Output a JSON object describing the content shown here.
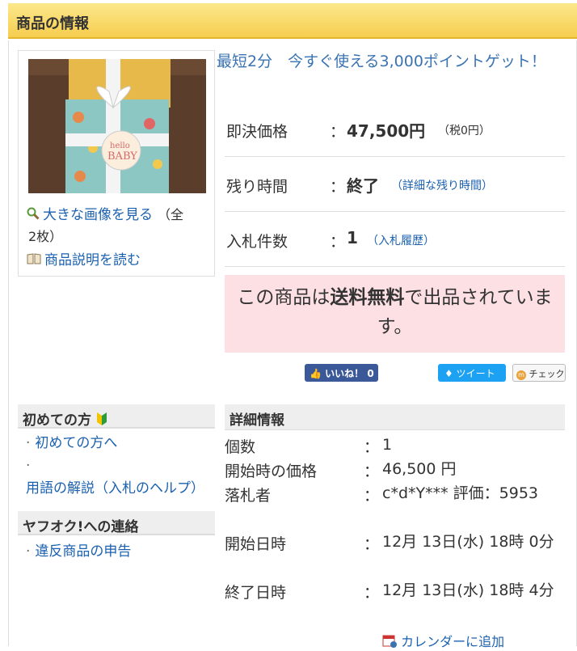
{
  "header": {
    "title": "商品の情報"
  },
  "image_panel": {
    "photo_alt": "商品画像",
    "large_image_link": "大きな画像を見る",
    "image_count": "（全2枚）",
    "description_link": "商品説明を読む"
  },
  "promo": {
    "text": "最短2分　今すぐ使える3,000ポイントゲット！"
  },
  "price": {
    "label": "即決価格",
    "colon": "：",
    "value": "47,500円",
    "tax": "（税0円）"
  },
  "time_left": {
    "label": "残り時間",
    "colon": "：",
    "value": "終了",
    "detail_link": "（詳細な残り時間）"
  },
  "bids": {
    "label": "入札件数",
    "colon": "：",
    "value": "1",
    "history_link": "（入札履歴）"
  },
  "shipping": {
    "prefix": "この商品は",
    "highlight": "送料無料",
    "suffix": "で出品されています。"
  },
  "social": {
    "like": "いいね！ 0",
    "tweet": "ツイート",
    "check": "チェック"
  },
  "sidebar": {
    "beginner_title": "初めての方",
    "beginner_items": [
      "初めての方へ",
      "用語の解説（入札のヘルプ）"
    ],
    "contact_title": "ヤフオク!への連絡",
    "contact_items": [
      "違反商品の申告"
    ]
  },
  "details": {
    "title": "詳細情報",
    "rows": [
      {
        "label": "個数",
        "colon": "：",
        "value": "1"
      },
      {
        "label": "開始時の価格",
        "colon": "：",
        "value": "46,500 円"
      },
      {
        "label": "落札者",
        "colon": "：",
        "value": "c*d*Y*** 評価：5953"
      },
      {
        "label": "開始日時",
        "colon": "：",
        "value": "12月 13日(水) 18時 0分"
      },
      {
        "label": "終了日時",
        "colon": "：",
        "value": "12月 13日(水) 18時 4分"
      }
    ],
    "calendar_link": "カレンダーに追加"
  },
  "colors": {
    "header_bg": "#f6cd4f",
    "link": "#1b61b0",
    "shipping_bg": "#fde0e4",
    "facebook": "#3b5998",
    "twitter": "#1da1f2"
  }
}
